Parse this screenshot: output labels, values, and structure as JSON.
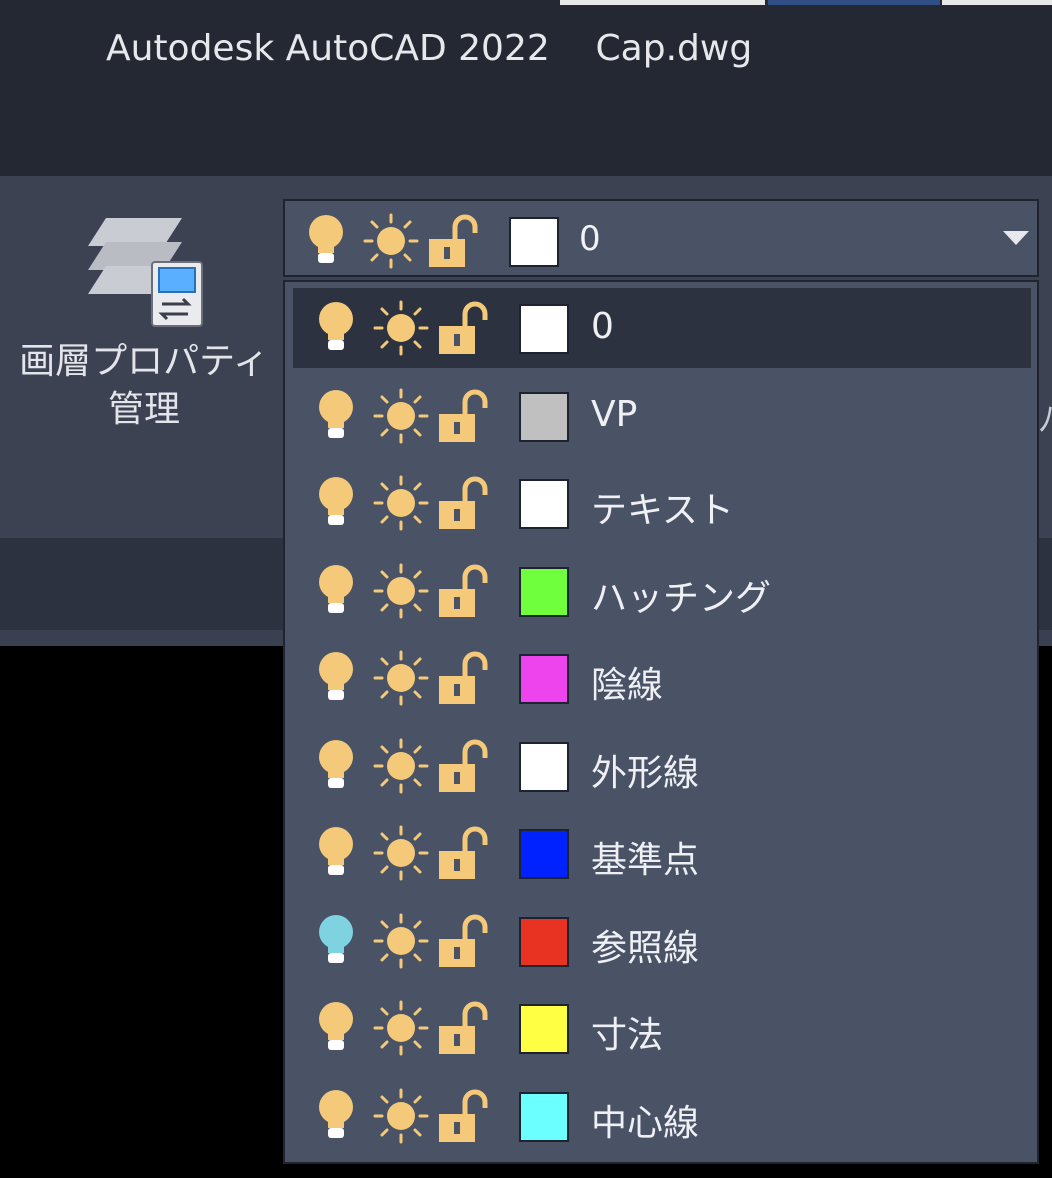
{
  "window": {
    "title": "Autodesk AutoCAD 2022    Cap.dwg"
  },
  "ribbon": {
    "layer_properties_button": {
      "label_line1": "画層プロパティ",
      "label_line2": "管理",
      "icon": "layer-properties-icon"
    },
    "side_glyph": "ﾉ"
  },
  "layer_combo": {
    "current_layer": "0",
    "current_color": "#ffffff",
    "arrow_icon": "chevron-down-icon"
  },
  "layers": [
    {
      "name": "0",
      "color": "#ffffff",
      "bulb": "on",
      "selected": true
    },
    {
      "name": "VP",
      "color": "#c0c0c0",
      "bulb": "on",
      "selected": false
    },
    {
      "name": "テキスト",
      "color": "#ffffff",
      "bulb": "on",
      "selected": false
    },
    {
      "name": "ハッチング",
      "color": "#6fff3c",
      "bulb": "on",
      "selected": false
    },
    {
      "name": "陰線",
      "color": "#ee44ee",
      "bulb": "on",
      "selected": false
    },
    {
      "name": "外形線",
      "color": "#ffffff",
      "bulb": "on",
      "selected": false
    },
    {
      "name": "基準点",
      "color": "#0022ff",
      "bulb": "on",
      "selected": false
    },
    {
      "name": "参照線",
      "color": "#e83222",
      "bulb": "off",
      "selected": false
    },
    {
      "name": "寸法",
      "color": "#ffff44",
      "bulb": "on",
      "selected": false
    },
    {
      "name": "中心線",
      "color": "#6cffff",
      "bulb": "on",
      "selected": false
    }
  ],
  "icon_colors": {
    "bulb_on": "#f4c97a",
    "bulb_off": "#7fd3e0",
    "sun": "#f4c97a",
    "lock": "#f4c97a"
  }
}
